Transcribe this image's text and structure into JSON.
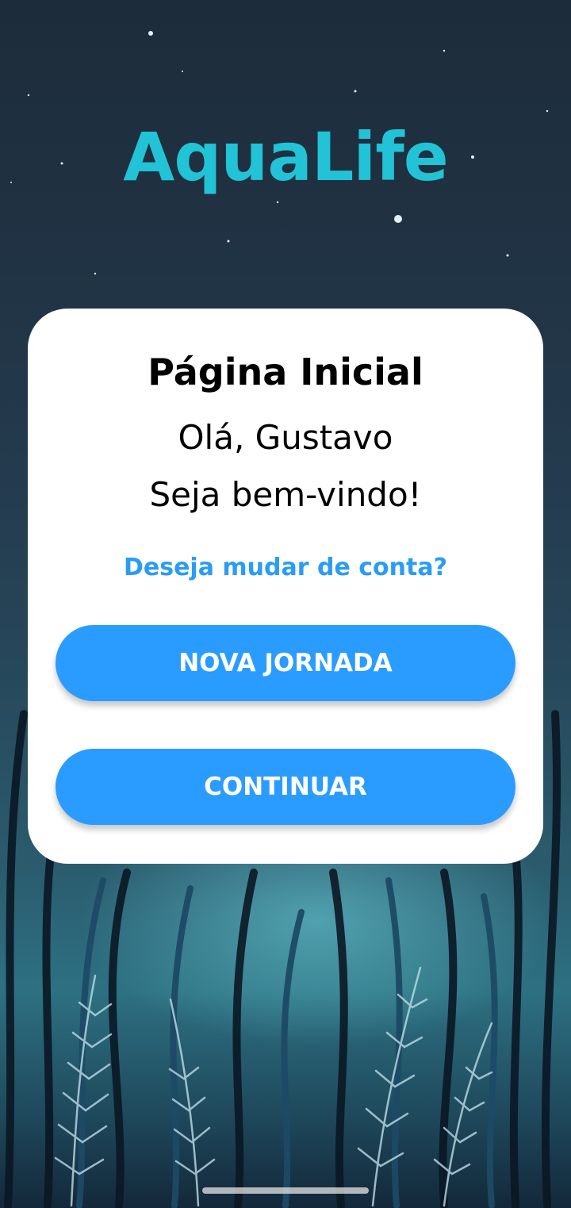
{
  "app": {
    "title": "AquaLife",
    "title_color": "#22c3d6"
  },
  "card": {
    "title": "Página Inicial",
    "greeting": "Olá, Gustavo",
    "welcome": "Seja bem-vindo!",
    "switch_account_link": "Deseja mudar de conta?",
    "buttons": {
      "new_journey": "NOVA JORNADA",
      "continue": "CONTINUAR"
    }
  },
  "colors": {
    "accent": "#2a9cff",
    "link": "#2a9cf4",
    "card_background": "#ffffff"
  },
  "background": {
    "description_icon": "underwater-seaweed-illustration"
  }
}
